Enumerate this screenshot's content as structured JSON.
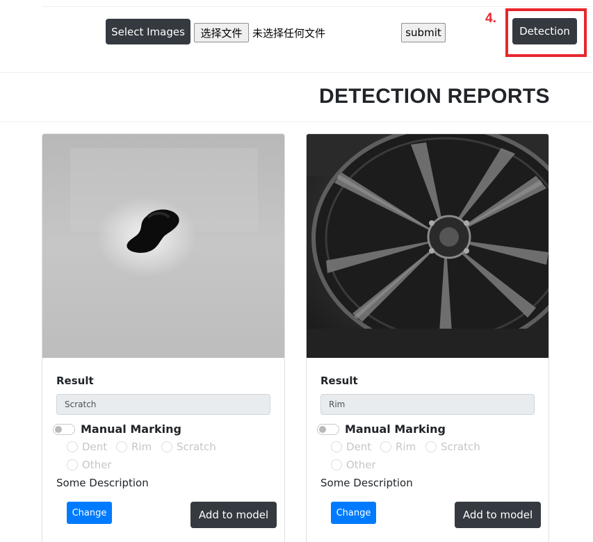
{
  "toolbar": {
    "select_images_label": "Select Images",
    "choose_file_label": "选择文件",
    "no_file_text": "未选择任何文件",
    "submit_label": "submit",
    "step_label": "4.",
    "detection_label": "Detection"
  },
  "reports_title": "DETECTION REPORTS",
  "cards": [
    {
      "result_label": "Result",
      "result_value": "Scratch",
      "manual_marking_label": "Manual Marking",
      "manual_marking_on": false,
      "options": [
        "Dent",
        "Rim",
        "Scratch",
        "Other"
      ],
      "description": "Some Description",
      "change_label": "Change",
      "add_label": "Add to model"
    },
    {
      "result_label": "Result",
      "result_value": "Rim",
      "manual_marking_label": "Manual Marking",
      "manual_marking_on": false,
      "options": [
        "Dent",
        "Rim",
        "Scratch",
        "Other"
      ],
      "description": "Some Description",
      "change_label": "Change",
      "add_label": "Add to model"
    }
  ],
  "colors": {
    "dark_button": "#343a40",
    "primary_button": "#007bff",
    "highlight": "#e8262c"
  }
}
